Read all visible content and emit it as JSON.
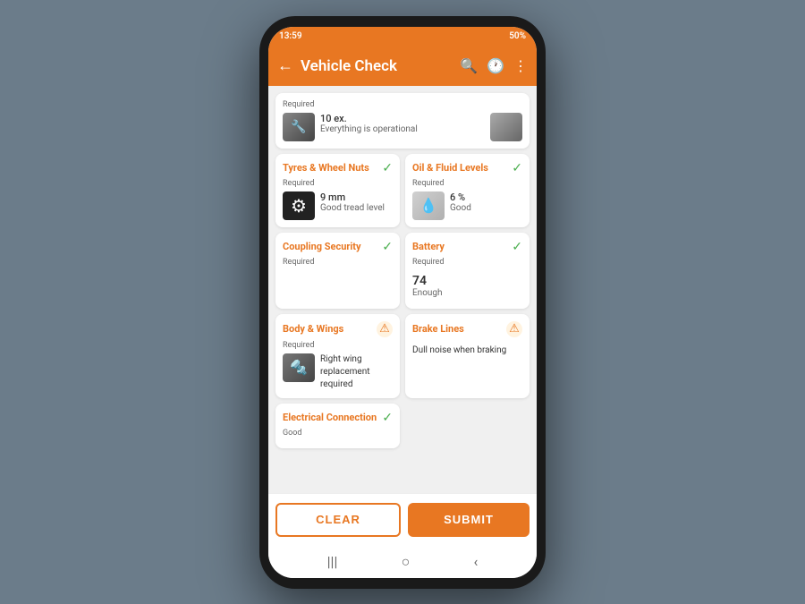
{
  "statusBar": {
    "time": "13:59",
    "battery": "50%",
    "signal": "▲"
  },
  "topBar": {
    "title": "Vehicle Check",
    "backIcon": "←",
    "searchIcon": "🔍",
    "historyIcon": "🕐",
    "menuIcon": "⋮"
  },
  "partialCard": {
    "label": "Required",
    "value": "10 ex.",
    "status": "Everything is operational"
  },
  "cards": [
    {
      "id": "tyres",
      "title": "Tyres & Wheel Nuts",
      "status": "check",
      "label": "Required",
      "value": "9 mm",
      "detail": "Good tread level",
      "hasThumb": true,
      "thumbType": "tyre"
    },
    {
      "id": "oil",
      "title": "Oil & Fluid Levels",
      "status": "check",
      "label": "Required",
      "value": "6 %",
      "detail": "Good",
      "hasThumb": true,
      "thumbType": "oil"
    },
    {
      "id": "coupling",
      "title": "Coupling Security",
      "status": "check",
      "label": "Required",
      "value": "",
      "detail": "",
      "hasThumb": false
    },
    {
      "id": "battery",
      "title": "Battery",
      "status": "check",
      "label": "Required",
      "value": "74",
      "detail": "Enough",
      "hasThumb": false
    },
    {
      "id": "wings",
      "title": "Body & Wings",
      "status": "warning",
      "label": "Required",
      "value": "Right wing replacement required",
      "detail": "",
      "hasThumb": true,
      "thumbType": "wing"
    },
    {
      "id": "brakes",
      "title": "Brake Lines",
      "status": "warning",
      "label": "",
      "value": "Dull noise when braking",
      "detail": "",
      "hasThumb": false
    },
    {
      "id": "electrical",
      "title": "Electrical Connection",
      "status": "check",
      "label": "Good",
      "value": "",
      "detail": "",
      "hasThumb": false
    }
  ],
  "buttons": {
    "clear": "CLEAR",
    "submit": "SUBMIT"
  },
  "navIcons": {
    "menu": "|||",
    "home": "○",
    "back": "‹"
  }
}
